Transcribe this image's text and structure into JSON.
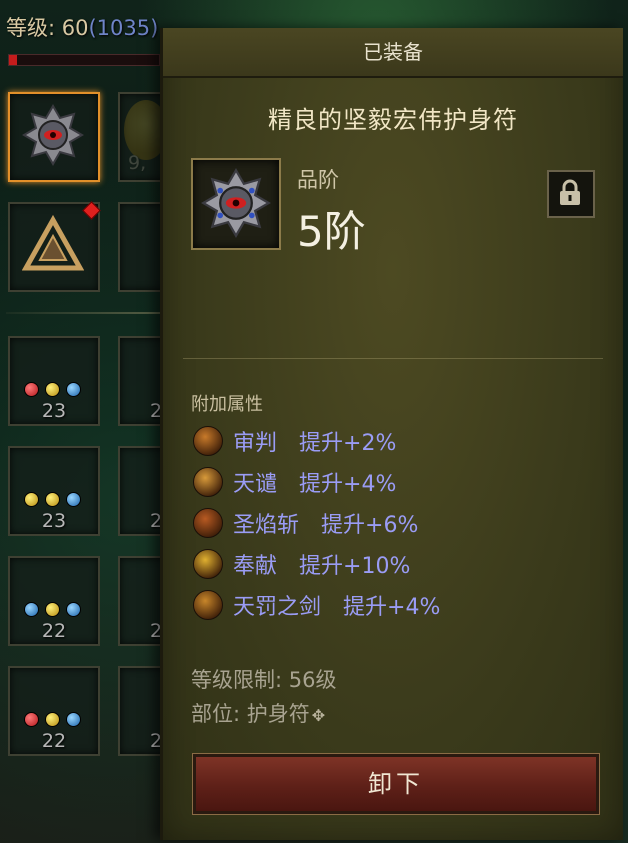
{
  "background": {
    "level_label": "等级: 60",
    "level_paren": "(1035)",
    "xp_fraction": 0.05,
    "partial_count": "9,",
    "slot_counts": [
      "23",
      "23",
      "22",
      "22"
    ],
    "slot_counts_cut": [
      "2",
      "2",
      "2",
      "2"
    ]
  },
  "tooltip": {
    "header": "已装备",
    "item_name": "精良的坚毅宏伟护身符",
    "grade_label": "品阶",
    "grade_value": "5阶",
    "lock_icon": "padlock-icon",
    "attributes_title": "附加属性",
    "attributes": [
      {
        "name": "审判",
        "bonus": "提升+2%",
        "icon": "judgment-icon",
        "color": "#c87a2a"
      },
      {
        "name": "天谴",
        "bonus": "提升+4%",
        "icon": "fist-of-heavens-icon",
        "color": "#d89a3a"
      },
      {
        "name": "圣焰斩",
        "bonus": "提升+6%",
        "icon": "holy-flame-slash-icon",
        "color": "#b85a22"
      },
      {
        "name": "奉献",
        "bonus": "提升+10%",
        "icon": "consecration-icon",
        "color": "#e0b030"
      },
      {
        "name": "天罚之剑",
        "bonus": "提升+4%",
        "icon": "heavens-sword-icon",
        "color": "#c8862a"
      }
    ],
    "level_requirement": "等级限制: 56级",
    "slot_label": "部位: 护身符",
    "slot_icon": "amulet-slot-icon",
    "unequip_label": "卸下"
  },
  "colors": {
    "attribute_text": "#9a9cf5",
    "selected_border": "#e2902a",
    "button_red": "#6e2a1e"
  }
}
